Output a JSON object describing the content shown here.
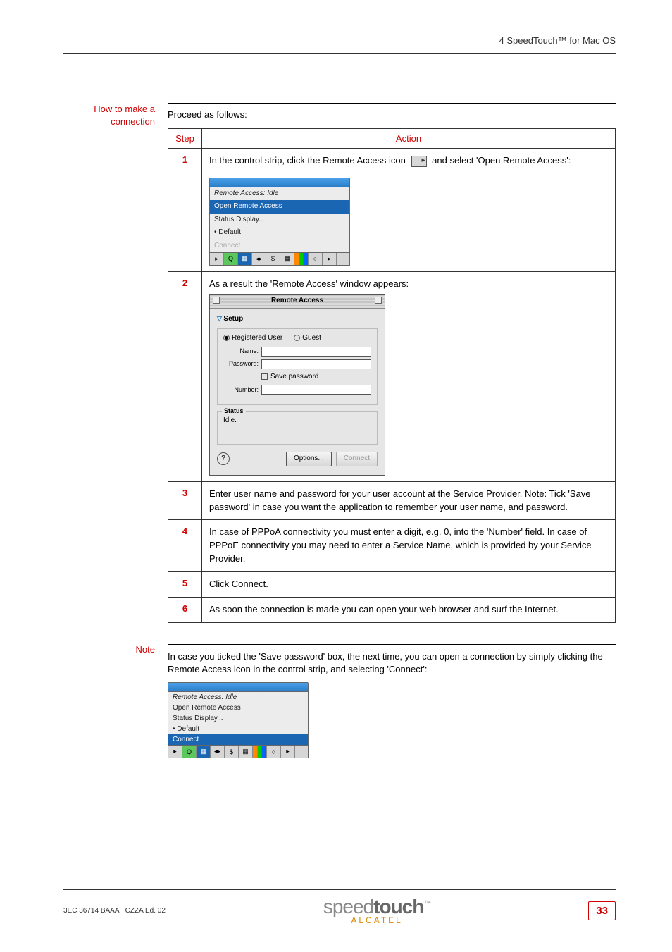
{
  "header": {
    "chapter": "4  SpeedTouch™ for Mac OS"
  },
  "section1": {
    "sideHeading": "How to make a connection",
    "intro": "Proceed as follows:",
    "tableHeaders": {
      "step": "Step",
      "action": "Action"
    },
    "steps": {
      "s1": {
        "num": "1",
        "textA": "In the control strip, click the Remote Access icon",
        "textB": "and select 'Open Remote Access':",
        "menu": {
          "title": "Remote Access: Idle",
          "item1": "Open Remote Access",
          "item2": "Status Display...",
          "item3": "Default",
          "item4": "Connect"
        }
      },
      "s2": {
        "num": "2",
        "text": "As a result the 'Remote Access' window appears:",
        "window": {
          "title": "Remote Access",
          "setup": "Setup",
          "regUser": "Registered User",
          "guest": "Guest",
          "name": "Name:",
          "password": "Password:",
          "savepw": "Save password",
          "number": "Number:",
          "statusLegend": "Status",
          "statusText": "Idle.",
          "help": "?",
          "options": "Options...",
          "connect": "Connect"
        }
      },
      "s3": {
        "num": "3",
        "text": "Enter user name and password for your user account at the Service Provider. Note: Tick 'Save password' in case you want the application to remember your user name, and password."
      },
      "s4": {
        "num": "4",
        "text": "In case of PPPoA connectivity you must enter a digit, e.g. 0, into the 'Number' field. In case of PPPoE connectivity you may need to enter a Service Name, which is provided by your Service Provider."
      },
      "s5": {
        "num": "5",
        "text": "Click Connect."
      },
      "s6": {
        "num": "6",
        "text": "As soon the connection is made you can open your web browser and surf the Internet."
      }
    }
  },
  "section2": {
    "sideHeading": "Note",
    "text": "In case you ticked the 'Save password' box, the next time, you can open a connection by simply clicking the Remote Access icon in the control strip, and selecting 'Connect':",
    "menu": {
      "title": "Remote Access: Idle",
      "item1": "Open Remote Access",
      "item2": "Status Display...",
      "item3": "Default",
      "item4": "Connect"
    }
  },
  "footer": {
    "left": "3EC 36714 BAAA TCZZA Ed. 02",
    "logo1": "speed",
    "logo2": "touch",
    "tm": "™",
    "alcatel": "ALCATEL",
    "page": "33"
  }
}
